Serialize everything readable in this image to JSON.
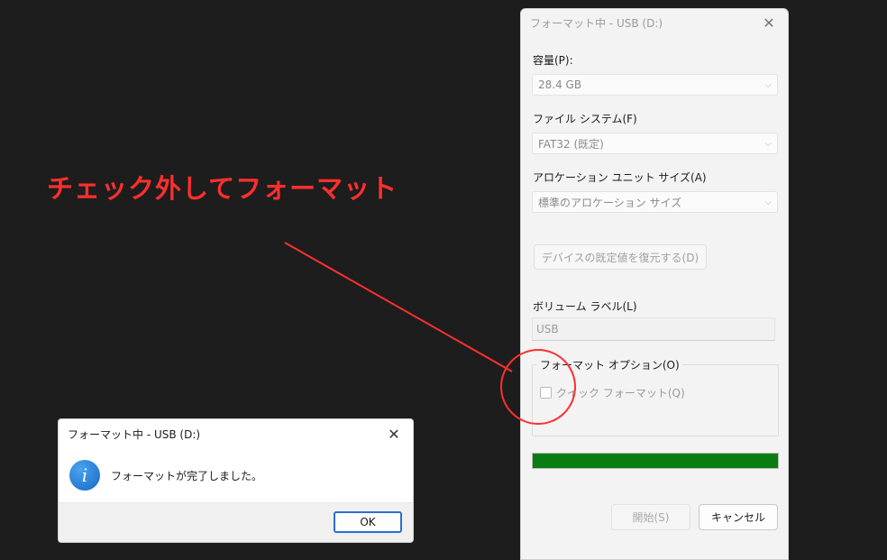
{
  "annotation": {
    "text": "チェック外してフォーマット",
    "color": "#ff2f2f"
  },
  "format_dialog": {
    "title": "フォーマット中 - USB (D:)",
    "capacity_label": "容量(P):",
    "capacity_value": "28.4 GB",
    "filesystem_label": "ファイル システム(F)",
    "filesystem_value": "FAT32 (既定)",
    "allocation_label": "アロケーション ユニット サイズ(A)",
    "allocation_value": "標準のアロケーション サイズ",
    "restore_defaults_label": "デバイスの既定値を復元する(D)",
    "volume_label_label": "ボリューム ラベル(L)",
    "volume_label_value": "USB",
    "format_options_label": "フォーマット オプション(O)",
    "quick_format_label": "クイック フォーマット(Q)",
    "quick_format_checked": false,
    "progress_fraction": 1.0,
    "progress_color": "#0a7d12",
    "start_label": "開始(S)",
    "cancel_label": "キャンセル",
    "close_icon": "close-icon"
  },
  "message_dialog": {
    "title": "フォーマット中 - USB (D:)",
    "message": "フォーマットが完了しました。",
    "icon": "info-icon",
    "icon_glyph": "i",
    "ok_label": "OK"
  }
}
